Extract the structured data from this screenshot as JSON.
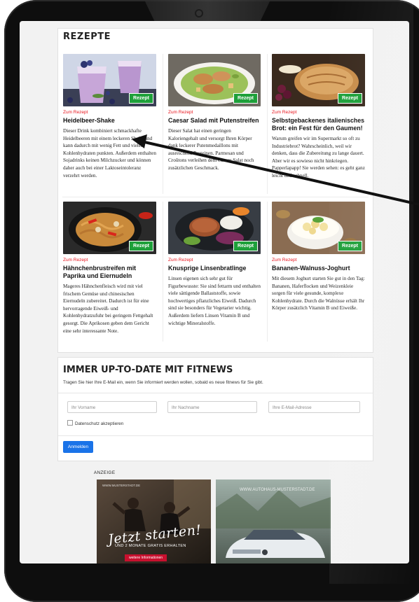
{
  "recipes_section": {
    "title": "REZEPTE",
    "badge_label": "Rezept",
    "tag_label": "Zum Rezept",
    "items": [
      {
        "title": "Heidelbeer-Shake",
        "text": "Dieser Drink kombiniert schmackhafte Heidelbeeren mit einem leckeren Shake und kann dadurch mit wenig Fett und vielen Kohlenhydraten punkten. Außerdem enthalten Sojadrinks keinen Milchzucker und können daher auch bei einer Laktoseintoleranz verzehrt werden."
      },
      {
        "title": "Caesar Salad mit Putenstreifen",
        "text": "Dieser Salat hat einen geringen Kaloriengehalt und versorgt Ihren Körper dank leckerer Putenmedaillons mit ausreichend Proteinen. Parmesan und Croûtons verleihen dem Caesar Salat noch zusätzlichen Geschmack."
      },
      {
        "title": "Selbstgebackenes italienisches Brot: ein Fest für den Gaumen!",
        "text": "Warum greifen wir im Supermarkt so oft zu Industriebrot? Wahrscheinlich, weil wir denken, dass die Zubereitung zu lange dauert. Aber wir es sowieso nicht hinkriegen. Papperlapapp! Sie werden sehen: es geht ganz leicht und schnell."
      },
      {
        "title": "Hähnchenbrustreifen mit Paprika und Eiernudeln",
        "text": "Mageres Hähnchenfleisch wird mit viel frischem Gemüse und chinesischen Eiernudeln zubereitet. Dadurch ist für eine hervorragende Eiweiß- und Kohlenhydratzufuhr bei geringem Fettgehalt gesorgt. Die Aprikosen geben dem Gericht eine sehr interessante Note."
      },
      {
        "title": "Knusprige Linsenbratlinge",
        "text": "Linsen eigenen sich sehr gut für Figurbewusste: Sie sind fettarm und enthalten viele sättigende Ballaststoffe, sowie hochwertiges pflanzliches Eiweiß. Dadurch sind sie besonders für Vegetarier wichtig. Außerdem liefern Linsen Vitamin B und wichtige Mineralstoffe."
      },
      {
        "title": "Bananen-Walnuss-Joghurt",
        "text": "Mit diesem Joghurt starten Sie gut in den Tag: Bananen, Haferflocken und Weizenkleie sorgen für viele gesunde, komplexe Kohlenhydrate. Durch die Walnüsse erhält Ihr Körper zusätzlich Vitamin B und Eiweiße."
      }
    ]
  },
  "newsletter": {
    "title": "IMMER UP-TO-DATE MIT FITNEWS",
    "subtitle": "Tragen Sie hier Ihre E-Mail ein, wenn Sie informiert werden wollen, sobald es neue fitnews für Sie gibt.",
    "firstname_placeholder": "Ihr Vorname",
    "lastname_placeholder": "Ihr Nachname",
    "email_placeholder": "Ihre E-Mail-Adresse",
    "privacy_label": "Datenschutz akzeptieren",
    "submit_label": "Anmelden"
  },
  "ads": {
    "label": "ANZEIGE",
    "ad1": {
      "url": "WWW.MUSTERSTADT.DE",
      "slogan": "Jetzt starten!",
      "subline": "UND 2 MONATE GRATIS ERHALTEN",
      "button": "weitere Informationen"
    },
    "ad2": {
      "url": "WWW.AUTOHAUS-MUSTERSTADT.DE"
    }
  },
  "colors": {
    "badge_green": "#1ea03a",
    "tag_red": "#e8141c",
    "button_blue": "#1a73e8",
    "ad_red": "#c8102e"
  }
}
